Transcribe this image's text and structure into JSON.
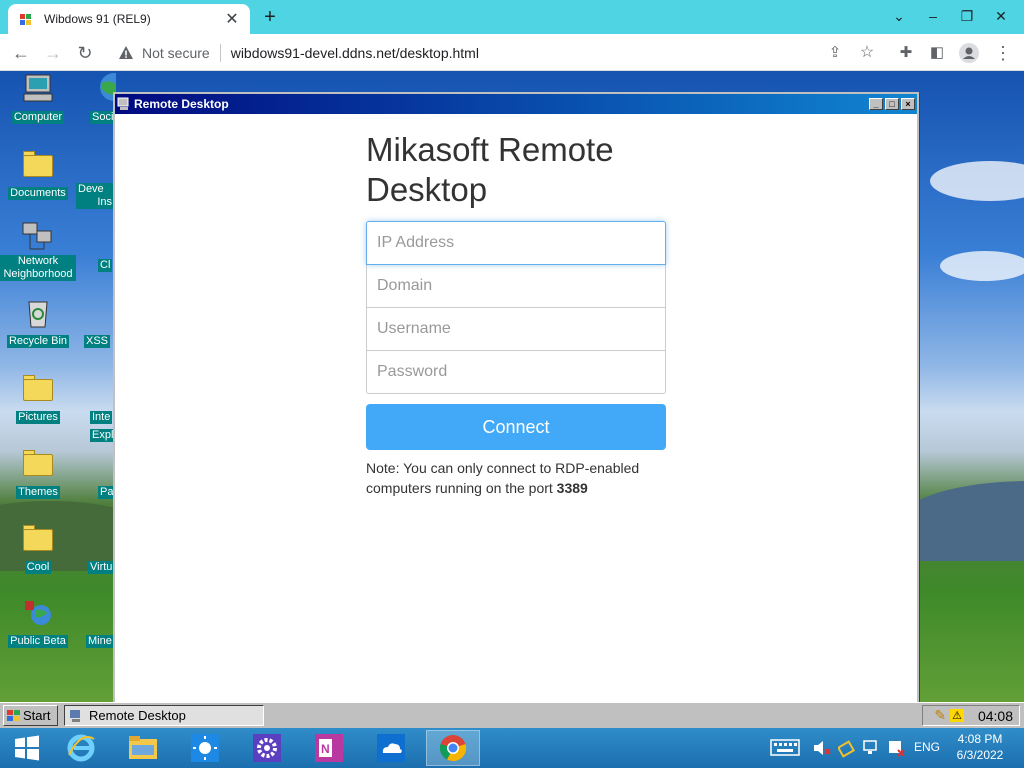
{
  "browser": {
    "tab_title": "Wibdows 91 (REL9)",
    "tab_close": "✕",
    "new_tab": "+",
    "not_secure": "Not secure",
    "url": "wibdows91-devel.ddns.net/desktop.html"
  },
  "desktop": {
    "icons": [
      {
        "label": "Computer"
      },
      {
        "label": "Documents"
      },
      {
        "label": "Network Neighborhood"
      },
      {
        "label": "Recycle Bin"
      },
      {
        "label": "Pictures"
      },
      {
        "label": "Themes"
      },
      {
        "label": "Cool"
      },
      {
        "label": "Public Beta"
      }
    ],
    "icons_col2": [
      {
        "label": "Soci"
      },
      {
        "label": "Deve"
      },
      {
        "label": "Ins"
      },
      {
        "label": "Cl"
      },
      {
        "label": "XSS"
      },
      {
        "label": "Inte"
      },
      {
        "label": "Expl"
      },
      {
        "label": "Pa"
      },
      {
        "label": "Virtu"
      },
      {
        "label": "Mine"
      }
    ]
  },
  "remote_desktop": {
    "window_title": "Remote Desktop",
    "heading": "Mikasoft Remote Desktop",
    "ip_placeholder": "IP Address",
    "domain_placeholder": "Domain",
    "username_placeholder": "Username",
    "password_placeholder": "Password",
    "connect_label": "Connect",
    "note_text": "Note: You can only connect to RDP-enabled computers running on the port",
    "note_port": "3389"
  },
  "w91_taskbar": {
    "start_label": "Start",
    "task_label": "Remote Desktop",
    "clock": "04:08"
  },
  "host_taskbar": {
    "language": "ENG",
    "time": "4:08 PM",
    "date": "6/3/2022"
  },
  "colors": {
    "chrome_tabbar": "#4fd4e4",
    "win91_titlebar": "#000a80",
    "connect_button": "#41a9f8",
    "desktop_label_bg": "#008080"
  }
}
